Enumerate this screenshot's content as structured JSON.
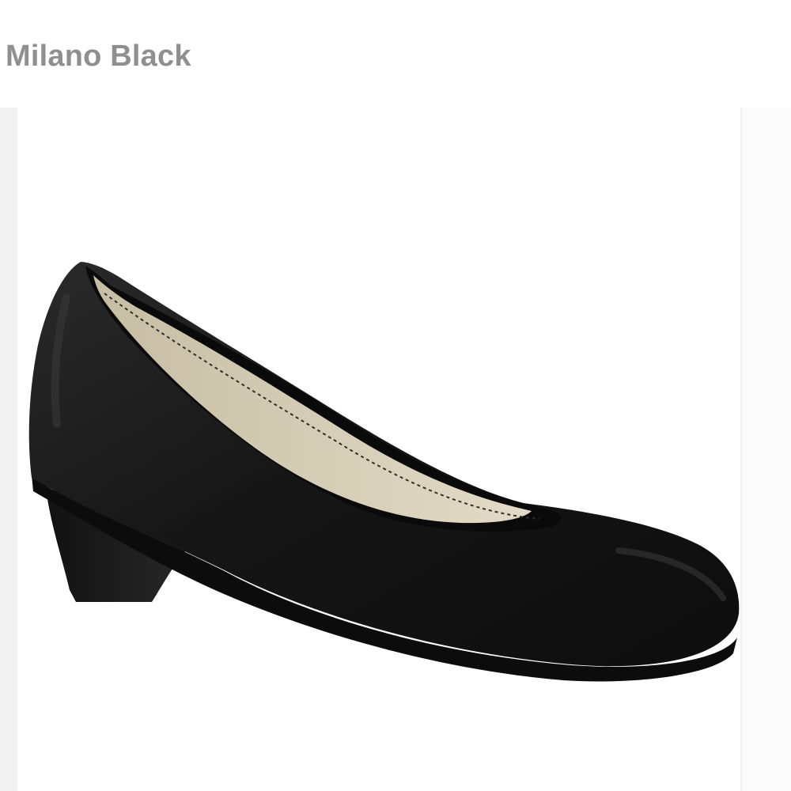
{
  "product": {
    "title": "Milano Black"
  },
  "image": {
    "subject": "black-leather-pump"
  },
  "colors": {
    "title": "#8f8f8f",
    "carousel_bg": "#f2f2f2",
    "shoe_leather": "#151515",
    "shoe_lining": "#d7cfb9",
    "peek_accent": "#1f4b5a"
  }
}
